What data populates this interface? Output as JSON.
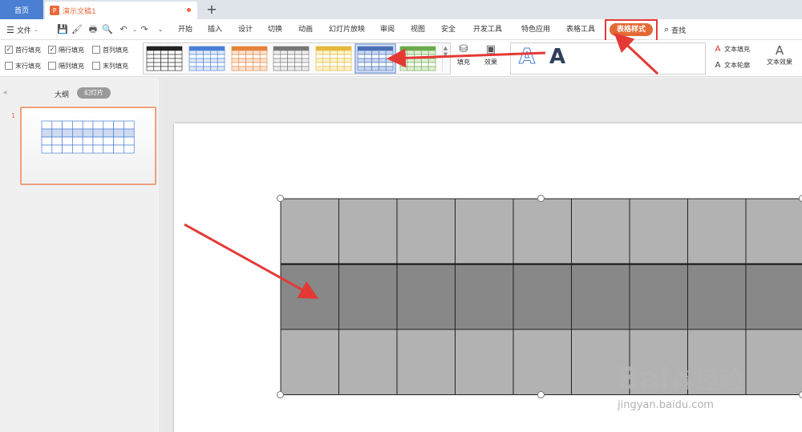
{
  "titlebar": {
    "home_tab": "首页",
    "doc_tab": "演示文稿1",
    "doc_icon": "P",
    "add_tab": "+"
  },
  "menubar": {
    "file": "文件",
    "items": [
      "开始",
      "插入",
      "设计",
      "切换",
      "动画",
      "幻灯片放映",
      "审阅",
      "视图",
      "安全",
      "开发工具",
      "特色应用",
      "表格工具"
    ],
    "active": "表格样式",
    "find": "查找"
  },
  "ribbon": {
    "checkboxes": [
      {
        "label": "首行填充",
        "checked": true
      },
      {
        "label": "隔行填充",
        "checked": true
      },
      {
        "label": "首列填充",
        "checked": false
      },
      {
        "label": "末行填充",
        "checked": false
      },
      {
        "label": "隔列填充",
        "checked": false
      },
      {
        "label": "末列填充",
        "checked": false
      }
    ],
    "gallery_styles": [
      {
        "color": "#222222",
        "fill": "#ffffff"
      },
      {
        "color": "#4a7fd3",
        "fill": "#dfe8f7"
      },
      {
        "color": "#e8823b",
        "fill": "#fbe3d2"
      },
      {
        "color": "#777777",
        "fill": "#eeeeee"
      },
      {
        "color": "#e5b83a",
        "fill": "#fdf2c9"
      },
      {
        "color": "#4a6fb5",
        "fill": "#c9d7f0"
      },
      {
        "color": "#6aaa4a",
        "fill": "#dfeed5"
      }
    ],
    "selected_style": 5,
    "fill_label": "填充",
    "effect_label": "效果",
    "text_fill": "文本填充",
    "text_outline": "文本轮廓",
    "text_effect": "文本效果"
  },
  "leftpanel": {
    "outline_tab": "大纲",
    "slides_tab": "幻灯片",
    "slide_number": "1"
  },
  "table": {
    "rows": 3,
    "cols": 9,
    "row_fill": [
      "#b2b2b2",
      "#888888",
      "#b2b2b2"
    ]
  },
  "watermark": {
    "logo": "Bai",
    "logo_tail": "经验",
    "url": "jingyan.baidu.com"
  },
  "colors": {
    "accent": "#e46a35",
    "annotation": "#e53935",
    "tab_blue": "#4a7fd3"
  }
}
